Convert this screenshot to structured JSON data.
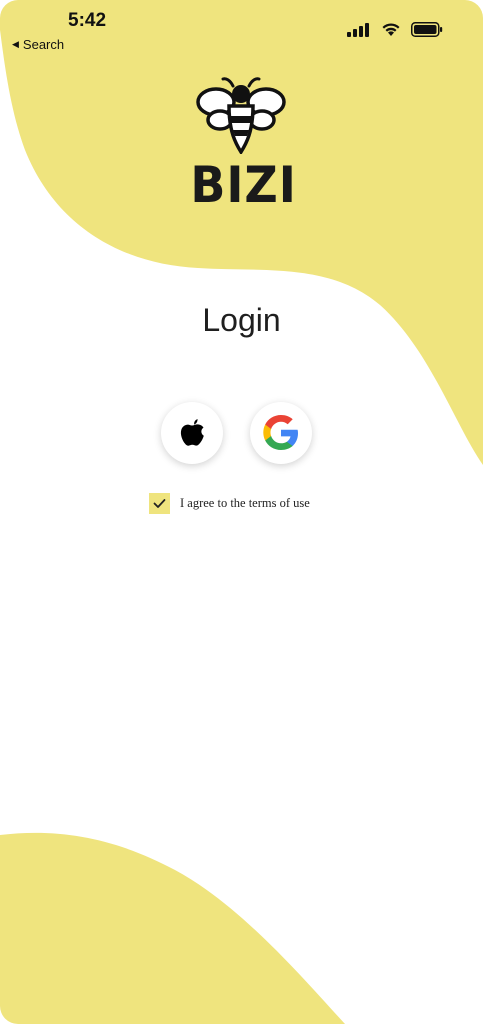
{
  "status_bar": {
    "time": "5:42",
    "back_label": "Search",
    "icons": [
      "signal-icon",
      "wifi-icon",
      "battery-icon"
    ]
  },
  "brand": {
    "name": "BIZI",
    "logo_icon": "bee-icon"
  },
  "login": {
    "title": "Login",
    "providers": [
      {
        "name": "Apple",
        "icon": "apple-icon"
      },
      {
        "name": "Google",
        "icon": "google-icon"
      }
    ],
    "terms_label": "I agree to the terms of use",
    "terms_checked": true
  },
  "colors": {
    "accent_yellow": "#efe47e",
    "background": "#ffffff",
    "text": "#1f1f1f"
  }
}
